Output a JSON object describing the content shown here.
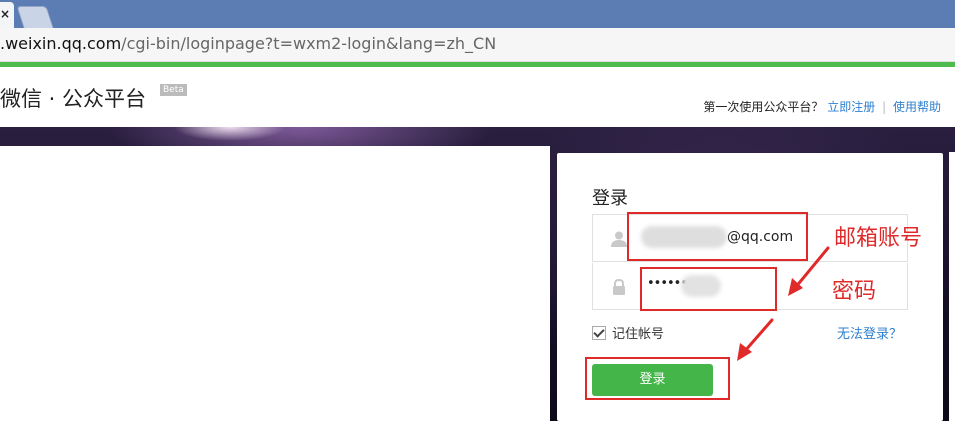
{
  "browser": {
    "tab_close_glyph": "×",
    "url_prefix": ".weixin.qq.com",
    "url_rest": "/cgi-bin/loginpage?t=wxm2-login&lang=zh_CN"
  },
  "header": {
    "brand": "微信 · 公众平台",
    "beta": "Beta",
    "first_time": "第一次使用公众平台？",
    "register": "立即注册",
    "separator": "|",
    "help": "使用帮助"
  },
  "login": {
    "title": "登录",
    "account_suffix": "@qq.com",
    "password_mask": "••••••",
    "remember_label": "记住帐号",
    "remember_checked": true,
    "forgot": "无法登录？",
    "submit": "登录"
  },
  "annotations": {
    "account_label": "邮箱账号",
    "password_label": "密码",
    "color": "#e02a2a"
  },
  "colors": {
    "accent_green": "#44b549",
    "link_blue": "#2f7fd0"
  }
}
